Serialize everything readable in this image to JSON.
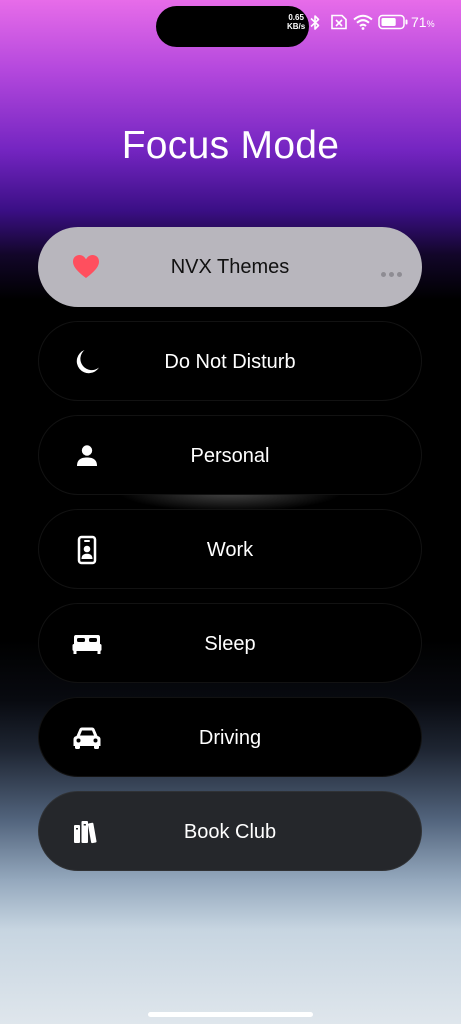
{
  "status_bar": {
    "speed_value": "0.65",
    "speed_unit": "KB/s",
    "battery_percent": "71",
    "battery_unit": "%",
    "battery_level": 0.71,
    "icons": [
      "bluetooth-icon",
      "sim-disabled-icon",
      "wifi-icon",
      "battery-icon"
    ]
  },
  "title": "Focus Mode",
  "focus_items": [
    {
      "label": "NVX Themes",
      "icon": "heart-icon",
      "state": "selected",
      "accent": "#ff4f5e"
    },
    {
      "label": "Do Not Disturb",
      "icon": "moon-icon"
    },
    {
      "label": "Personal",
      "icon": "person-icon"
    },
    {
      "label": "Work",
      "icon": "id-badge-icon"
    },
    {
      "label": "Sleep",
      "icon": "bed-icon"
    },
    {
      "label": "Driving",
      "icon": "car-icon"
    },
    {
      "label": "Book Club",
      "icon": "books-icon"
    }
  ]
}
